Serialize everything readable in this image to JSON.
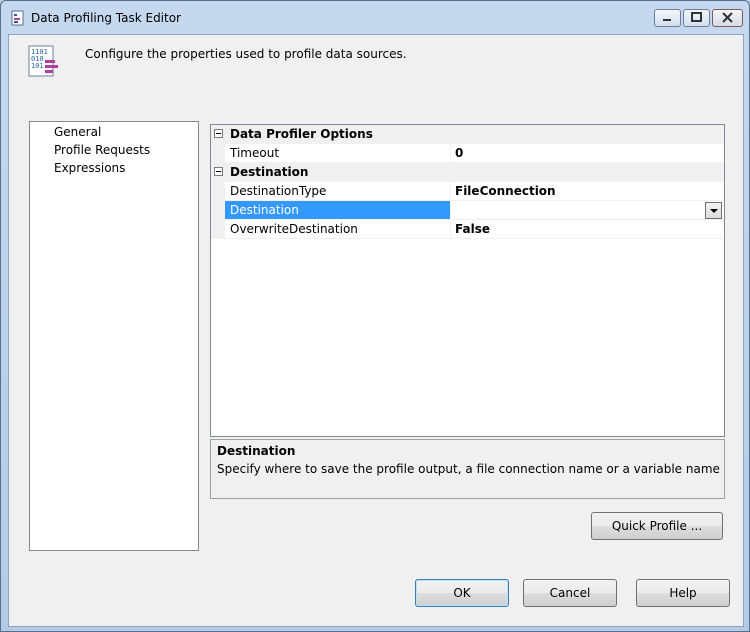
{
  "window": {
    "title": "Data Profiling Task Editor"
  },
  "header": {
    "text": "Configure the properties used to profile data sources."
  },
  "nav": {
    "items": [
      {
        "label": "General"
      },
      {
        "label": "Profile Requests"
      },
      {
        "label": "Expressions"
      }
    ]
  },
  "grid": {
    "cat1": {
      "label": "Data Profiler Options"
    },
    "timeout": {
      "name": "Timeout",
      "value": "0"
    },
    "cat2": {
      "label": "Destination"
    },
    "destination_type": {
      "name": "DestinationType",
      "value": "FileConnection"
    },
    "destination": {
      "name": "Destination",
      "value": ""
    },
    "overwrite": {
      "name": "OverwriteDestination",
      "value": "False"
    }
  },
  "description": {
    "title": "Destination",
    "text": "Specify where to save the profile output, a file connection name or a variable name"
  },
  "buttons": {
    "quick_profile": "Quick Profile ...",
    "ok": "OK",
    "cancel": "Cancel",
    "help": "Help"
  },
  "colors": {
    "selection": "#3399ff",
    "frame": "#b9d1ea"
  }
}
